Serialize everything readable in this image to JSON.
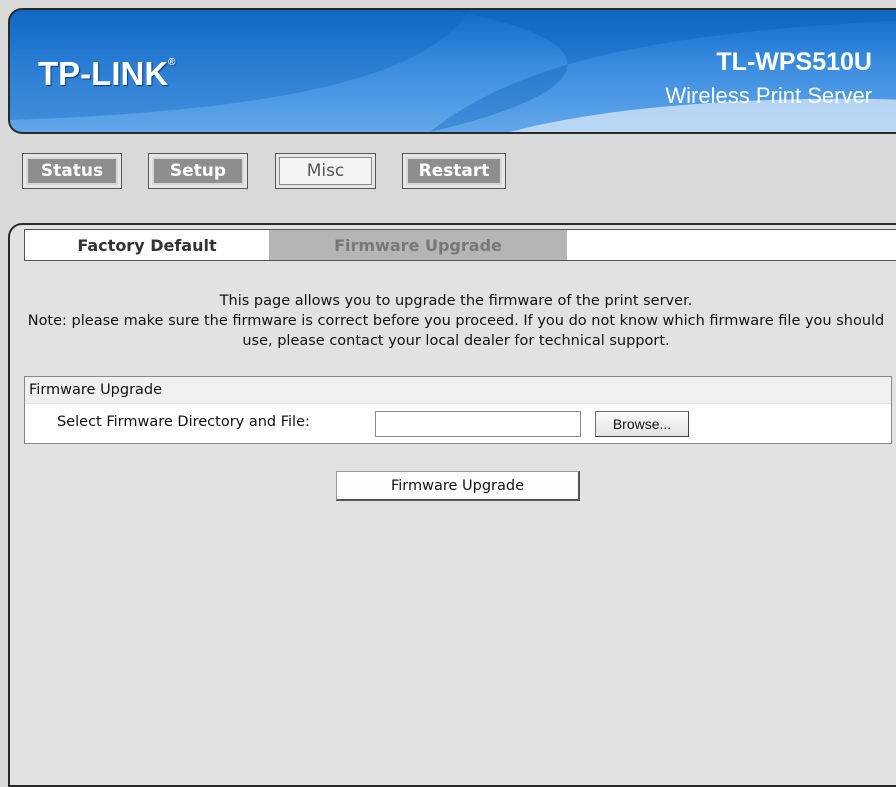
{
  "header": {
    "logo_text": "TP-LINK",
    "logo_mark": "®",
    "model": "TL-WPS510U",
    "subtitle": "Wireless Print Server"
  },
  "nav": {
    "items": [
      {
        "label": "Status"
      },
      {
        "label": "Setup"
      },
      {
        "label": "Misc",
        "active": true
      },
      {
        "label": "Restart"
      }
    ]
  },
  "tabs": {
    "factory_default": "Factory Default",
    "firmware_upgrade": "Firmware Upgrade",
    "selected": "Firmware Upgrade"
  },
  "info": {
    "line1": "This page allows you to upgrade the firmware of the print server.",
    "line2": "Note: please make sure the firmware is correct before you proceed. If you do not know which firmware file you should use, please contact your local dealer for technical support."
  },
  "firmware_box": {
    "title": "Firmware Upgrade",
    "field_label": "Select Firmware Directory and File:",
    "field_value": "",
    "browse_label": "Browse..."
  },
  "actions": {
    "upgrade_label": "Firmware Upgrade"
  },
  "colors": {
    "header_blue": "#1b6fcf",
    "page_bg": "#d9d9d9",
    "nav_button_gray": "#8e8e8e",
    "tab_selected_bg": "#b5b5b5"
  }
}
